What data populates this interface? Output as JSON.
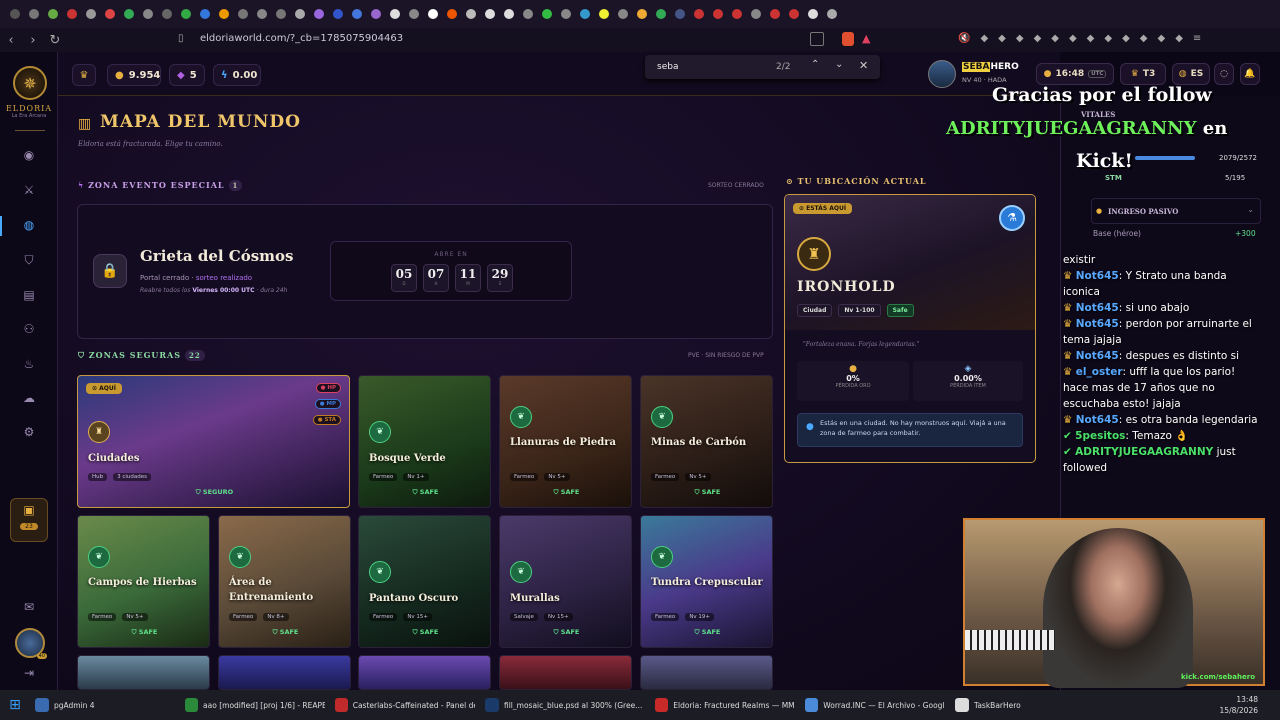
{
  "browser": {
    "url": "eldoriaworld.com/?_cb=1785075904463"
  },
  "find": {
    "query": "seba",
    "count": "2/2"
  },
  "logo": {
    "title": "ELDORIA",
    "subtitle": "La Era Arcana"
  },
  "resources": {
    "gold": "9.954",
    "gems": "5",
    "energy": "0.00"
  },
  "profile": {
    "name_part1": "SEBA",
    "name_part2": "HERO",
    "level": "NV 40 · HADA"
  },
  "header": {
    "time": "16:48",
    "tz": "UTC",
    "rank": "T3",
    "lang": "ES"
  },
  "page": {
    "title": "MAPA DEL MUNDO",
    "subtitle": "Eldoria está fracturada. Elige tu camino."
  },
  "event": {
    "section": "ZONA EVENTO ESPECIAL",
    "count": "1",
    "note": "SORTEO CERRADO",
    "name": "Grieta del Cósmos",
    "line1_a": "Portal cerrado · ",
    "line1_b": "sorteo realizado",
    "line2_a": "Reabre todos los ",
    "line2_b": "Viernes 00:00 UTC",
    "line2_c": " · dura 24h",
    "opens_label": "ABRE EN",
    "timer": [
      {
        "v": "05",
        "u": "D"
      },
      {
        "v": "07",
        "u": "H"
      },
      {
        "v": "11",
        "u": "M"
      },
      {
        "v": "29",
        "u": "S"
      }
    ]
  },
  "safe": {
    "section": "ZONAS SEGURAS",
    "count": "22",
    "note": "PVE · SIN RIESGO DE PVP"
  },
  "zones": [
    {
      "name": "Ciudades",
      "meta1": "Hub",
      "meta2": "3 ciudades",
      "status": "SEGURO",
      "here": "AQUÍ",
      "hp": "HP",
      "mp": "MP",
      "sta": "STA"
    },
    {
      "name": "Bosque Verde",
      "meta1": "Farmeo",
      "meta2": "Nv 1+",
      "status": "SAFE"
    },
    {
      "name": "Llanuras de Piedra",
      "meta1": "Farmeo",
      "meta2": "Nv 5+",
      "status": "SAFE"
    },
    {
      "name": "Minas de Carbón",
      "meta1": "Farmeo",
      "meta2": "Nv 5+",
      "status": "SAFE"
    },
    {
      "name": "Campos de Hierbas",
      "meta1": "Farmeo",
      "meta2": "Nv 5+",
      "status": "SAFE"
    },
    {
      "name": "Área de Entrenamiento",
      "meta1": "Farmeo",
      "meta2": "Nv 8+",
      "status": "SAFE"
    },
    {
      "name": "Pantano Oscuro",
      "meta1": "Farmeo",
      "meta2": "Nv 15+",
      "status": "SAFE"
    },
    {
      "name": "Murallas",
      "meta1": "Salvaje",
      "meta2": "Nv 15+",
      "status": "SAFE"
    },
    {
      "name": "Tundra Crepuscular",
      "meta1": "Farmeo",
      "meta2": "Nv 19+",
      "status": "SAFE"
    }
  ],
  "location": {
    "section": "TU UBICACIÓN ACTUAL",
    "here": "ESTÁS AQUÍ",
    "name": "IRONHOLD",
    "tag1": "Ciudad",
    "tag2": "Nv 1-100",
    "tag3": "Safe",
    "quote": "\"Fortaleza enana. Forjas legendarias.\"",
    "stat1_v": "0%",
    "stat1_l": "PÉRDIDA ORO",
    "stat2_v": "0.00%",
    "stat2_l": "PÉRDIDA ITEM",
    "info": "Estás en una ciudad. No hay monstruos aquí. Viajá a una zona de farmeo para combatir."
  },
  "rightpanel": {
    "vitals": "VITALES",
    "hp_val": "2079/2572",
    "stm": "STM",
    "stm_val": "5/195",
    "passive": "INGRESO PASIVO",
    "base_l": "Base (héroe)",
    "base_v": "+300"
  },
  "overlay": {
    "line1": "Gracias por el follow",
    "line2a": "ADRITYJUEGAAGRANNY",
    "line2b": " en",
    "line3": "Kick!"
  },
  "chat": [
    {
      "user": "",
      "text": "existir"
    },
    {
      "user": "Not645",
      "text": ": Y Strato una banda iconica"
    },
    {
      "user": "Not645",
      "text": ": si uno abajo"
    },
    {
      "user": "Not645",
      "text": ": perdon por arruinarte el tema jajaja"
    },
    {
      "user": "Not645",
      "text": ": despues es distinto si"
    },
    {
      "user": "el_oster",
      "text": ": ufff la que los pario! hace mas de 17 años que no escuchaba esto! jajaja"
    },
    {
      "user": "Not645",
      "text": ": es otra banda legendaria"
    },
    {
      "user": "5pesitos",
      "text": ": Temazo 👌"
    },
    {
      "user": "ADRITYJUEGAAGRANNY",
      "text": " just followed"
    }
  ],
  "cam": {
    "watermark": "kick.com/sebahero"
  },
  "sidebar": {
    "badge": "23",
    "avatar_level": "40"
  },
  "taskbar": {
    "items": [
      "pgAdmin 4",
      "aao [modified] [proj 1/6] - REAPE...",
      "Casterlabs-Caffeinated - Panel de ...",
      "fill_mosaic_blue.psd al 300% (Gree...",
      "Eldoria: Fractured Realms — MM...",
      "Worrad.INC — El Archivo - Googl...",
      "TaskBarHero"
    ],
    "time": "13:48",
    "date": "15/8/2026"
  }
}
